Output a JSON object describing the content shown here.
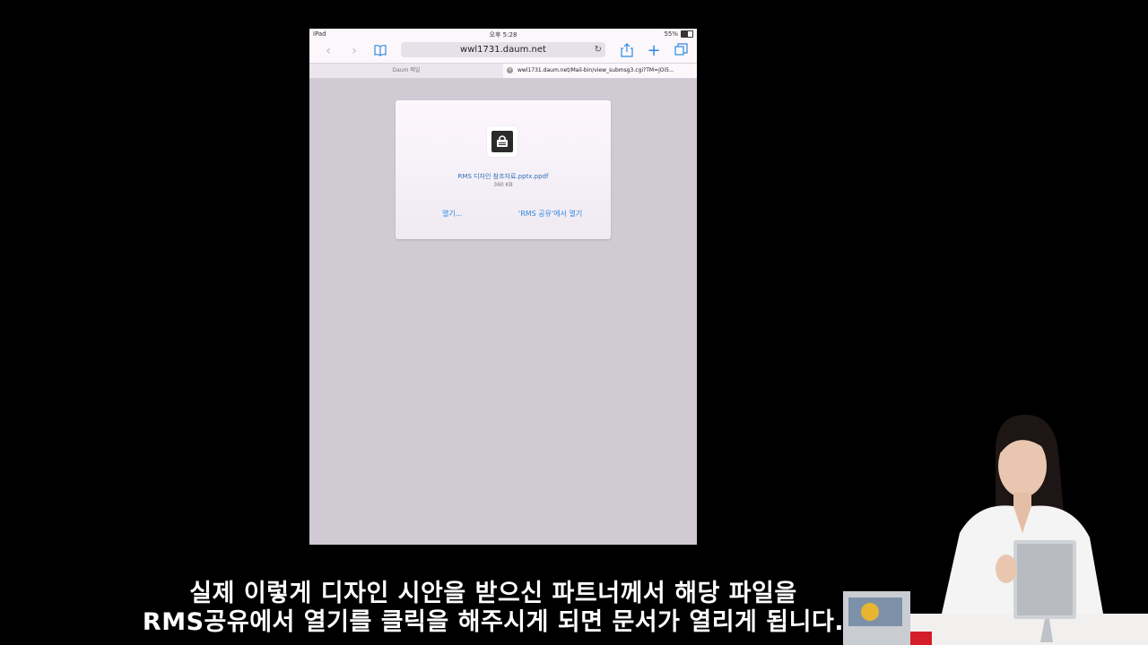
{
  "statusbar": {
    "device": "iPad",
    "time": "오후 5:28",
    "battery": "55%"
  },
  "toolbar": {
    "url": "wwl1731.daum.net"
  },
  "tabs": [
    {
      "label": "Daum 메일"
    },
    {
      "label": "wwl1731.daum.net/Mail-bin/view_submsg3.cgi?TM=jOi5..."
    }
  ],
  "dialog": {
    "filename": "RMS 디자인 참조자료.pptx.ppdf",
    "filesize": "360 KB",
    "open_label": "열기...",
    "open_in_label": "'RMS 공유'에서 열기"
  },
  "subtitle": {
    "line1": "실제 이렇게 디자인 시안을 받으신 파트너께서 해당 파일을",
    "line2": "RMS공유에서 열기를 클릭을 해주시게 되면 문서가 열리게 됩니다."
  },
  "colors": {
    "accent": "#2f8ae0",
    "ipad_background": "#cfcad3"
  },
  "battery_level": 0.55
}
